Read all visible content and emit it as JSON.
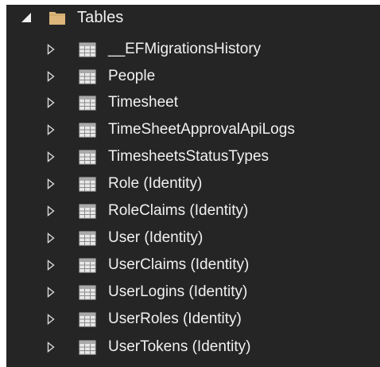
{
  "tree": {
    "root": {
      "label": "Tables",
      "icon": "folder-icon",
      "expanded": true
    },
    "items": [
      {
        "label": "__EFMigrationsHistory",
        "icon": "table-icon"
      },
      {
        "label": "People",
        "icon": "table-icon"
      },
      {
        "label": "Timesheet",
        "icon": "table-icon"
      },
      {
        "label": "TimeSheetApprovalApiLogs",
        "icon": "table-icon"
      },
      {
        "label": "TimesheetsStatusTypes",
        "icon": "table-icon"
      },
      {
        "label": "Role (Identity)",
        "icon": "table-icon"
      },
      {
        "label": "RoleClaims (Identity)",
        "icon": "table-icon"
      },
      {
        "label": "User (Identity)",
        "icon": "table-icon"
      },
      {
        "label": "UserClaims (Identity)",
        "icon": "table-icon"
      },
      {
        "label": "UserLogins (Identity)",
        "icon": "table-icon"
      },
      {
        "label": "UserRoles (Identity)",
        "icon": "table-icon"
      },
      {
        "label": "UserTokens (Identity)",
        "icon": "table-icon"
      }
    ]
  },
  "colors": {
    "background": "#252526",
    "text": "#f1f1f1",
    "folder": "#dcb67a",
    "table_grid": "#c8c8c8"
  }
}
